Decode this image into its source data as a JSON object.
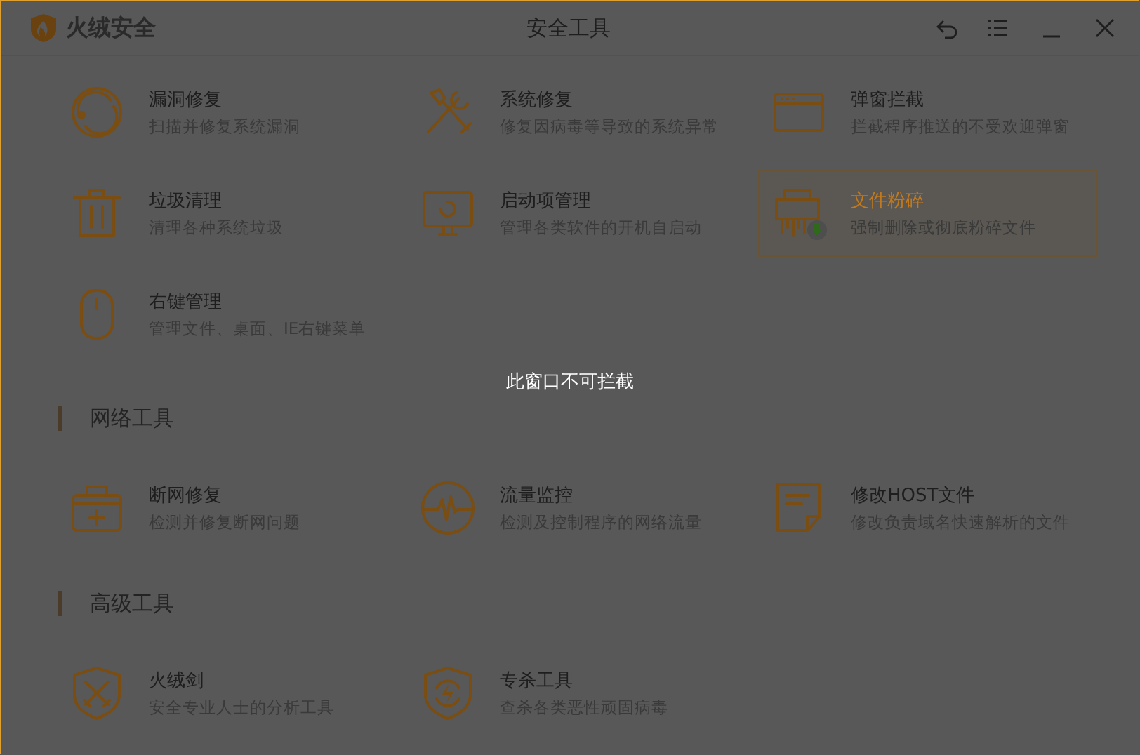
{
  "window": {
    "brand": "火绒安全",
    "title": "安全工具"
  },
  "sections": [
    {
      "items": [
        {
          "kind": "loophole",
          "title": "漏洞修复",
          "desc": "扫描并修复系统漏洞",
          "selected": false
        },
        {
          "kind": "repair",
          "title": "系统修复",
          "desc": "修复因病毒等导致的系统异常",
          "selected": false
        },
        {
          "kind": "popup",
          "title": "弹窗拦截",
          "desc": "拦截程序推送的不受欢迎弹窗",
          "selected": false
        },
        {
          "kind": "trash",
          "title": "垃圾清理",
          "desc": "清理各种系统垃圾",
          "selected": false
        },
        {
          "kind": "startup",
          "title": "启动项管理",
          "desc": "管理各类软件的开机自启动",
          "selected": false
        },
        {
          "kind": "shredder",
          "title": "文件粉碎",
          "desc": "强制删除或彻底粉碎文件",
          "selected": true
        },
        {
          "kind": "mouse",
          "title": "右键管理",
          "desc": "管理文件、桌面、IE右键菜单",
          "selected": false
        }
      ]
    },
    {
      "title": "网络工具",
      "items": [
        {
          "kind": "netfix",
          "title": "断网修复",
          "desc": "检测并修复断网问题",
          "selected": false
        },
        {
          "kind": "traffic",
          "title": "流量监控",
          "desc": "检测及控制程序的网络流量",
          "selected": false
        },
        {
          "kind": "host",
          "title": "修改HOST文件",
          "desc": "修改负责域名快速解析的文件",
          "selected": false
        }
      ]
    },
    {
      "title": "高级工具",
      "items": [
        {
          "kind": "sword",
          "title": "火绒剑",
          "desc": "安全专业人士的分析工具",
          "selected": false
        },
        {
          "kind": "kill",
          "title": "专杀工具",
          "desc": "查杀各类恶性顽固病毒",
          "selected": false
        }
      ]
    }
  ],
  "overlay": {
    "message": "此窗口不可拦截"
  }
}
